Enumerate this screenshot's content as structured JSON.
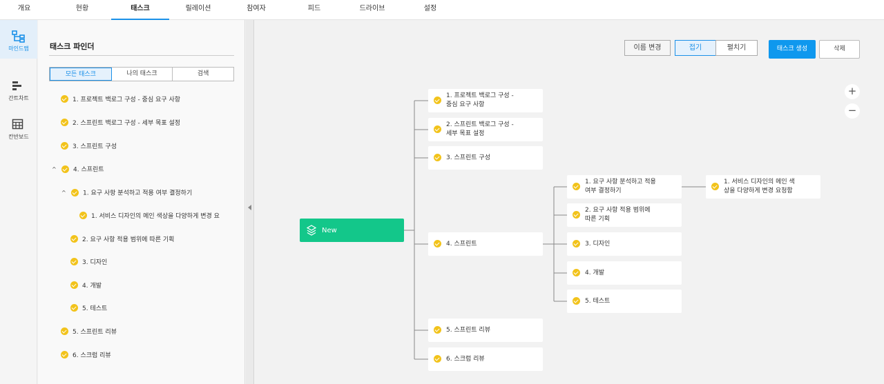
{
  "topnav": {
    "tabs": [
      {
        "label": "개요"
      },
      {
        "label": "현황"
      },
      {
        "label": "태스크"
      },
      {
        "label": "릴레이션"
      },
      {
        "label": "참여자"
      },
      {
        "label": "피드"
      },
      {
        "label": "드라이브"
      },
      {
        "label": "설정"
      }
    ],
    "active_index": 2
  },
  "rail": {
    "items": [
      {
        "label": "마인드맵",
        "icon": "mindmap-icon",
        "active": true
      },
      {
        "label": "간트차트",
        "icon": "gantt-icon",
        "active": false
      },
      {
        "label": "칸반보드",
        "icon": "kanban-icon",
        "active": false
      }
    ]
  },
  "finder": {
    "title": "태스크 파인더",
    "filters": [
      "모든 태스크",
      "나의 태스크",
      "검색"
    ],
    "active_filter": 0,
    "tree": [
      {
        "label": "1. 프로젝트 백로그 구성 - 중심 요구 사항",
        "depth": 0,
        "expanded": null
      },
      {
        "label": "2. 스프린트 백로그 구성 - 세부 목표 설정",
        "depth": 0,
        "expanded": null
      },
      {
        "label": "3. 스프린트 구성",
        "depth": 0,
        "expanded": null
      },
      {
        "label": "4. 스프린트",
        "depth": 0,
        "expanded": true
      },
      {
        "label": "1. 요구 사항 분석하고 적용 여부 결정하기",
        "depth": 1,
        "expanded": true
      },
      {
        "label": "1. 서비스 디자인의 메인 색상을 다양하게 변경 요",
        "depth": 2,
        "expanded": null
      },
      {
        "label": "2. 요구 사항 적용 범위에 따른 기획",
        "depth": 1,
        "expanded": null
      },
      {
        "label": "3. 디자인",
        "depth": 1,
        "expanded": null
      },
      {
        "label": "4. 개발",
        "depth": 1,
        "expanded": null
      },
      {
        "label": "5. 테스트",
        "depth": 1,
        "expanded": null
      },
      {
        "label": "5. 스프린트 리뷰",
        "depth": 0,
        "expanded": null
      },
      {
        "label": "6. 스크럼 리뷰",
        "depth": 0,
        "expanded": null
      }
    ]
  },
  "toolbar": {
    "rename_label": "이름 변경",
    "collapse_label": "접기",
    "expand_label": "펼치기",
    "create_label": "태스크 생성",
    "delete_label": "삭제",
    "zoom_in": "+",
    "zoom_out": "−"
  },
  "mindmap": {
    "root": "New",
    "level1": [
      [
        "1. 프로젝트 백로그 구성 -",
        "중심 요구 사항"
      ],
      [
        "2. 스프린트 백로그 구성 -",
        "세부 목표 설정"
      ],
      [
        "3. 스프린트 구성"
      ],
      [
        "4. 스프린트"
      ],
      [
        "5. 스프린트 리뷰"
      ],
      [
        "6. 스크럼 리뷰"
      ]
    ],
    "level2": [
      [
        "1. 요구 사항 분석하고 적용",
        "여부 결정하기"
      ],
      [
        "2. 요구 사항 적용 범위에",
        "따른 기획"
      ],
      [
        "3. 디자인"
      ],
      [
        "4. 개발"
      ],
      [
        "5. 테스트"
      ]
    ],
    "level3": [
      [
        "1. 서비스 디자인의 메인 색",
        "상을 다양하게 변경 요청함"
      ]
    ]
  },
  "colors": {
    "accent": "#1a90e8",
    "root_node": "#13c78a",
    "check": "#f2c31b"
  }
}
